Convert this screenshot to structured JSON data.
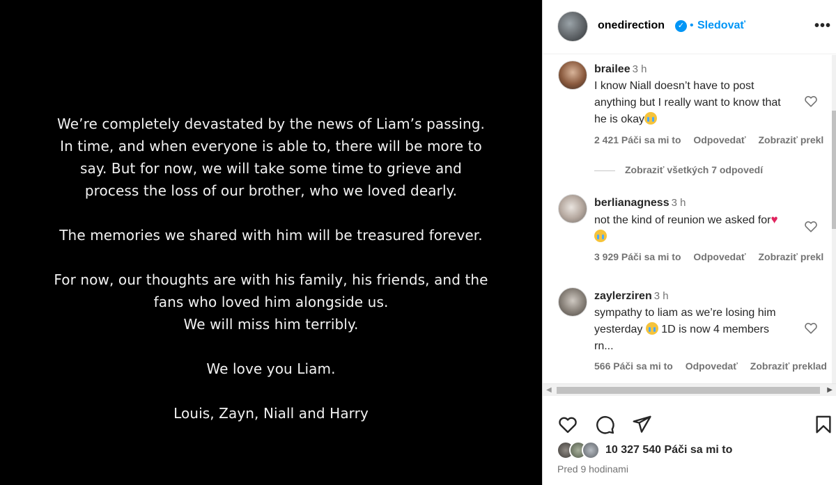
{
  "post": {
    "paragraphs": [
      [
        "We’re completely devastated by the news of Liam’s passing.",
        "In time, and when everyone is able to, there will be more to",
        "say. But for now, we will take some time to grieve and",
        "process the loss of our brother, who we loved dearly."
      ],
      [
        "The memories we shared with him will be treasured forever."
      ],
      [
        "For now, our thoughts are with his family, his friends, and the",
        "fans who loved him alongside us.",
        "We will miss him terribly."
      ],
      [
        "We love you Liam."
      ],
      [
        "Louis, Zayn, Niall and Harry"
      ]
    ]
  },
  "header": {
    "username": "onedirection",
    "verified_icon": "verified-badge-icon",
    "separator": "•",
    "follow_label": "Sledovať",
    "more_label": "•••"
  },
  "comments": [
    {
      "username": "brailee",
      "time": "3 h",
      "text": "I know Niall doesn’t have to post anything but I really want to know that he is okay",
      "emoji": "crying-face-emoji",
      "likes": "2 421 Páči sa mi to",
      "reply": "Odpovedať",
      "translate": "Zobraziť prekl"
    },
    {
      "username": "berlianagness",
      "time": "3 h",
      "text": "not the kind of reunion we asked for",
      "emoji": "red-heart-and-crying-face-emoji",
      "likes": "3 929 Páči sa mi to",
      "reply": "Odpovedať",
      "translate": "Zobraziť prekl"
    },
    {
      "username": "zaylerziren",
      "time": "3 h",
      "text_before": "sympathy to liam as we’re losing him yesterday",
      "text_after": " 1D is now 4 members rn...",
      "emoji": "crying-face-emoji",
      "likes": "566 Páči sa mi to",
      "reply": "Odpovedať",
      "translate": "Zobraziť preklad"
    }
  ],
  "view_replies": "Zobraziť všetkých 7 odpovedí",
  "likes_total": "10 327 540 Páči sa mi to",
  "timestamp": "Pred 9 hodinami",
  "icons": [
    "heart-icon",
    "comment-icon",
    "share-icon",
    "bookmark-icon"
  ],
  "colors": {
    "accent": "#0095f6",
    "muted": "#737373",
    "post_bg": "#000000"
  }
}
